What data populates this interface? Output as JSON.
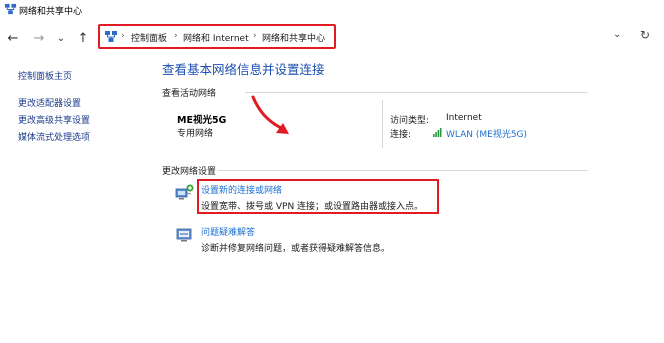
{
  "window": {
    "title": "网络和共享中心"
  },
  "nav": {
    "back": "←",
    "forward": "→",
    "recent": "⌄",
    "up": "↑",
    "breadcrumb": [
      "控制面板",
      "网络和 Internet",
      "网络和共享中心"
    ],
    "separator": "›",
    "dropdown": "⌄",
    "refresh": "↻"
  },
  "sidebar": {
    "items": [
      {
        "label": "控制面板主页"
      },
      {
        "label": "更改适配器设置"
      },
      {
        "label": "更改高级共享设置"
      },
      {
        "label": "媒体流式处理选项"
      }
    ]
  },
  "main": {
    "heading": "查看基本网络信息并设置连接",
    "active_networks_label": "查看活动网络",
    "network": {
      "name": "ME视光5G",
      "type": "专用网络",
      "access_type_label": "访问类型:",
      "access_type_value": "Internet",
      "connections_label": "连接:",
      "connection_value": "WLAN (ME视光5G)"
    },
    "change_settings_label": "更改网络设置",
    "tasks": [
      {
        "title": "设置新的连接或网络",
        "desc": "设置宽带、拨号或 VPN 连接；或设置路由器或接入点。"
      },
      {
        "title": "问题疑难解答",
        "desc": "诊断并修复网络问题，或者获得疑难解答信息。"
      }
    ]
  },
  "colors": {
    "highlight": "#e01b24",
    "link": "#1c6fd0",
    "heading": "#1c4fb0",
    "sidebar_link": "#1a3a8a"
  }
}
